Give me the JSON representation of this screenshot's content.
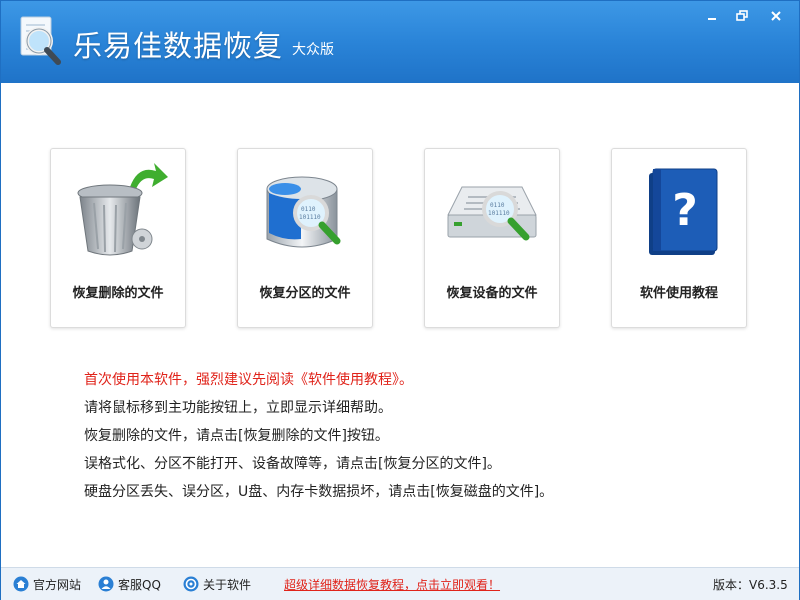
{
  "window": {
    "title": "乐易佳数据恢复",
    "edition": "大众版",
    "controls": [
      "minimize",
      "restore",
      "close"
    ]
  },
  "cards": [
    {
      "label": "恢复删除的文件",
      "icon": "recycle-bin-icon"
    },
    {
      "label": "恢复分区的文件",
      "icon": "partition-magnifier-icon"
    },
    {
      "label": "恢复设备的文件",
      "icon": "device-magnifier-icon"
    },
    {
      "label": "软件使用教程",
      "icon": "help-book-icon"
    }
  ],
  "tips": [
    "首次使用本软件，强烈建议先阅读《软件使用教程》。",
    "请将鼠标移到主功能按钮上，立即显示详细帮助。",
    "恢复删除的文件，请点击[恢复删除的文件]按钮。",
    "误格式化、分区不能打开、设备故障等，请点击[恢复分区的文件]。",
    "硬盘分区丢失、误分区，U盘、内存卡数据损坏，请点击[恢复磁盘的文件]。"
  ],
  "statusbar": {
    "website": "官方网站",
    "qq": "客服QQ",
    "about": "关于软件",
    "promo": "超级详细数据恢复教程，点击立即观看！",
    "version": "版本：V6.3.5"
  },
  "colors": {
    "titlebar": "#2a84d8",
    "tip_highlight": "#e0231a",
    "statusbar_bg": "#ecf2f9"
  }
}
